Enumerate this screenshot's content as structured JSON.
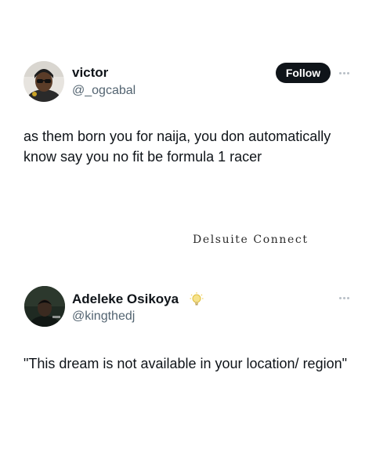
{
  "tweet1": {
    "display_name": "victor",
    "handle": "@_ogcabal",
    "follow_label": "Follow",
    "more_icon": "more-horizontal-icon",
    "text": "as them born you for naija, you don automatically know say you no fit be formula 1 racer"
  },
  "watermark": "Delsuite Connect",
  "tweet2": {
    "display_name": "Adeleke Osikoya",
    "badge_icon": "lightbulb-icon",
    "handle": "@kingthedj",
    "more_icon": "more-horizontal-icon",
    "text": "\"This dream is not available in your location/ region\""
  },
  "colors": {
    "text_primary": "#0f1419",
    "text_secondary": "#536471",
    "follow_bg": "#0f1419",
    "follow_text": "#ffffff",
    "badge": "#f2d35b"
  }
}
